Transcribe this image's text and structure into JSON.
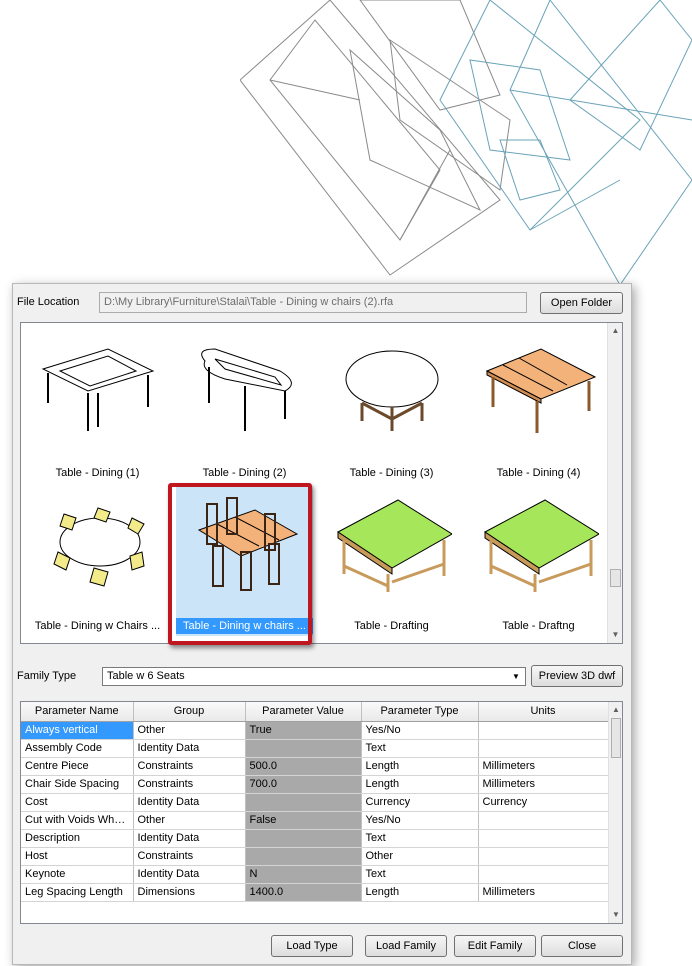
{
  "file_location": {
    "label": "File Location",
    "path": "D:\\My Library\\Furniture\\Stalai\\Table - Dining w chairs (2).rfa",
    "open_folder_label": "Open Folder"
  },
  "gallery": {
    "items": [
      {
        "caption": "Table - Dining (1)",
        "icon": "table-dining-1-thumbnail"
      },
      {
        "caption": "Table - Dining (2)",
        "icon": "table-dining-2-thumbnail"
      },
      {
        "caption": "Table - Dining (3)",
        "icon": "table-dining-3-thumbnail"
      },
      {
        "caption": "Table - Dining (4)",
        "icon": "table-dining-4-thumbnail"
      },
      {
        "caption": "Table - Dining w Chairs ...",
        "icon": "table-dining-chairs-thumbnail"
      },
      {
        "caption": "Table - Dining w chairs ...",
        "icon": "table-dining-chairs-2-thumbnail",
        "selected": true
      },
      {
        "caption": "Table - Drafting",
        "icon": "table-drafting-thumbnail"
      },
      {
        "caption": "Table - Draftng",
        "icon": "table-draftng-thumbnail"
      }
    ]
  },
  "family_type": {
    "label": "Family Type",
    "value": "Table w 6 Seats",
    "preview_label": "Preview 3D dwf"
  },
  "params": {
    "headers": [
      "Parameter Name",
      "Group",
      "Parameter Value",
      "Parameter Type",
      "Units"
    ],
    "rows": [
      [
        "Always vertical",
        "Other",
        "True",
        "Yes/No",
        ""
      ],
      [
        "Assembly Code",
        "Identity Data",
        "",
        "Text",
        ""
      ],
      [
        "Centre Piece",
        "Constraints",
        "500.0",
        "Length",
        "Millimeters"
      ],
      [
        "Chair Side Spacing",
        "Constraints",
        "700.0",
        "Length",
        "Millimeters"
      ],
      [
        "Cost",
        "Identity Data",
        "",
        "Currency",
        "Currency"
      ],
      [
        "Cut with Voids Whe...",
        "Other",
        "False",
        "Yes/No",
        ""
      ],
      [
        "Description",
        "Identity Data",
        "",
        "Text",
        ""
      ],
      [
        "Host",
        "Constraints",
        "",
        "Other",
        ""
      ],
      [
        "Keynote",
        "Identity Data",
        "N",
        "Text",
        ""
      ],
      [
        "Leg Spacing Length",
        "Dimensions",
        "1400.0",
        "Length",
        "Millimeters"
      ]
    ]
  },
  "buttons": {
    "load_type": "Load Type",
    "load_family": "Load Family",
    "edit_family": "Edit Family",
    "close": "Close"
  },
  "colors": {
    "selection_highlight": "#3399ff",
    "selection_frame": "#c0161f",
    "value_column": "#a9a9a9",
    "table_top_wood": "#f2b27a",
    "drafting_top_green": "#a6e65a"
  }
}
